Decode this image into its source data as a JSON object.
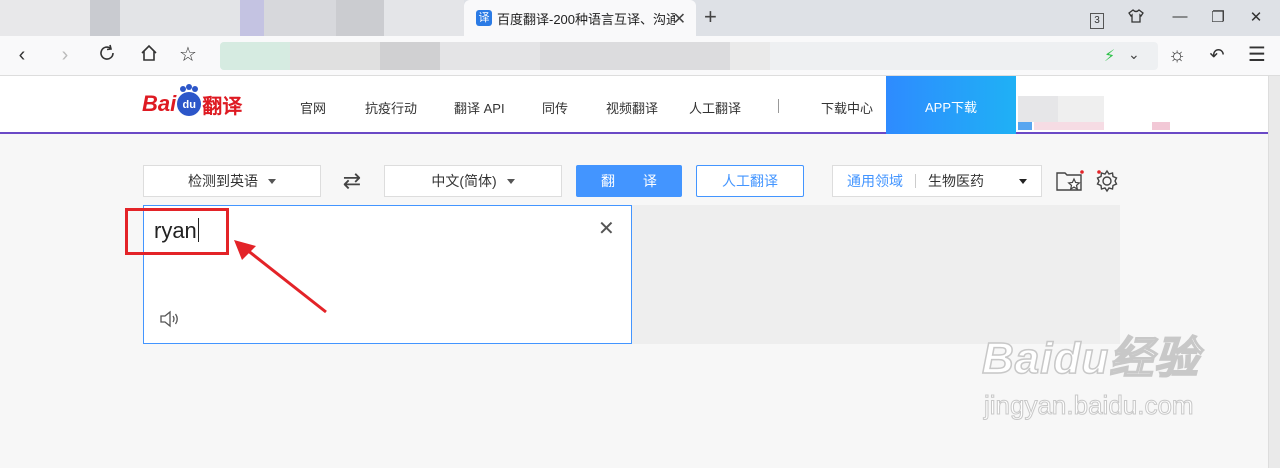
{
  "browser": {
    "tab": {
      "favicon": "译",
      "title": "百度翻译-200种语言互译、沟通"
    },
    "tab_counter": "3",
    "address_blurred": true
  },
  "header": {
    "logo": {
      "bai": "Bai",
      "du": "du",
      "fanyi": "翻译"
    },
    "nav": [
      {
        "label": "官网"
      },
      {
        "label": "抗疫行动"
      },
      {
        "label": "翻译 API"
      },
      {
        "label": "同传"
      },
      {
        "label": "视频翻译"
      },
      {
        "label": "人工翻译"
      },
      {
        "label": "下载中心"
      }
    ],
    "app_download": "APP下载"
  },
  "controls": {
    "source_lang": "检测到英语",
    "target_lang": "中文(简体)",
    "translate_button": "翻 译",
    "human_translate_button": "人工翻译",
    "domain_label": "通用领域",
    "domain_value": "生物医药"
  },
  "input": {
    "text": "ryan"
  },
  "watermark": {
    "main": "Baidu经验",
    "sub": "jingyan.baidu.com"
  },
  "colors": {
    "accent": "#4395ff",
    "brand_red": "#de1a22",
    "highlight": "#e32328",
    "header_line": "#6a49c6"
  }
}
